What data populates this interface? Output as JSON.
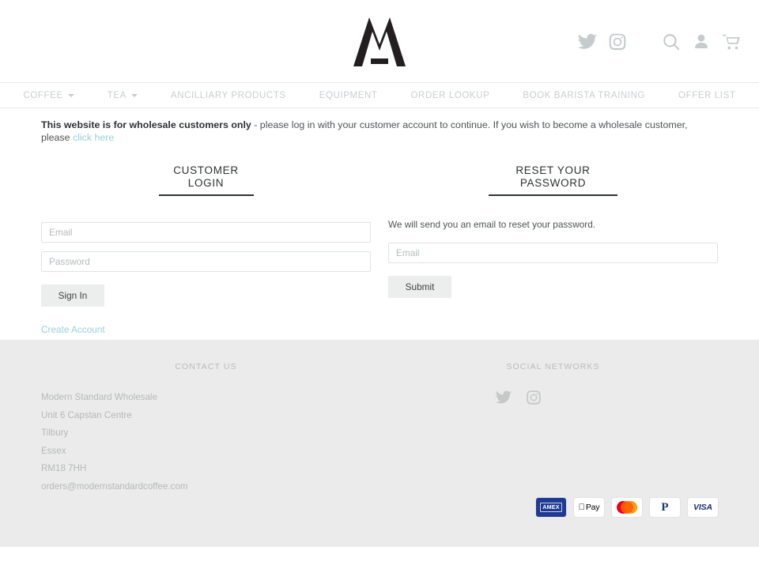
{
  "header": {
    "logo_alt": "Modern Standard M logo",
    "icons": [
      {
        "name": "twitter-icon",
        "label": "Twitter"
      },
      {
        "name": "instagram-icon",
        "label": "Instagram"
      },
      {
        "name": "search-icon",
        "label": "Search"
      },
      {
        "name": "user-account-icon",
        "label": "Account"
      },
      {
        "name": "shopping-cart-icon",
        "label": "Cart"
      }
    ]
  },
  "nav": {
    "items": [
      {
        "label": "COFFEE",
        "has_caret": true
      },
      {
        "label": "TEA",
        "has_caret": true
      },
      {
        "label": "ANCILLIARY PRODUCTS",
        "has_caret": false
      },
      {
        "label": "EQUIPMENT",
        "has_caret": false
      },
      {
        "label": "ORDER LOOKUP",
        "has_caret": false
      },
      {
        "label": "BOOK BARISTA TRAINING",
        "has_caret": false
      },
      {
        "label": "OFFER LIST",
        "has_caret": false
      }
    ]
  },
  "notice": {
    "bold": "This website is for wholesale customers only",
    "text": " - please log in with your customer account to continue. If you wish to become a wholesale customer, please ",
    "link": "click here"
  },
  "login": {
    "heading_line1": "CUSTOMER",
    "heading_line2": "LOGIN",
    "email_placeholder": "Email",
    "email_value": "",
    "password_placeholder": "Password",
    "password_value": "",
    "submit_label": "Sign In",
    "create_account_label": "Create Account"
  },
  "reset": {
    "heading_line1": "RESET YOUR",
    "heading_line2": "PASSWORD",
    "description": "We will send you an email to reset your password.",
    "email_placeholder": "Email",
    "email_value": "",
    "submit_label": "Submit"
  },
  "footer": {
    "contact_heading": "CONTACT US",
    "address_lines": [
      "Modern Standard Wholesale",
      "Unit 6 Capstan Centre",
      "Tilbury",
      "Essex",
      "RM18 7HH",
      "orders@modernstandardcoffee.com"
    ],
    "social_heading": "SOCIAL NETWORKS",
    "social_icons": [
      {
        "name": "twitter-icon",
        "label": "Twitter"
      },
      {
        "name": "instagram-icon",
        "label": "Instagram"
      }
    ],
    "payments": [
      {
        "name": "amex",
        "label": "AMEX"
      },
      {
        "name": "apple-pay",
        "label": "Pay"
      },
      {
        "name": "mastercard",
        "label": "Mastercard"
      },
      {
        "name": "paypal",
        "label": "PayPal"
      },
      {
        "name": "visa",
        "label": "VISA"
      }
    ]
  },
  "colors": {
    "link": "#9ad0da",
    "nav_text": "#c9cdcf",
    "footer_bg": "#ebebeb",
    "heading": "#2e3133",
    "button_bg": "#eceded"
  }
}
